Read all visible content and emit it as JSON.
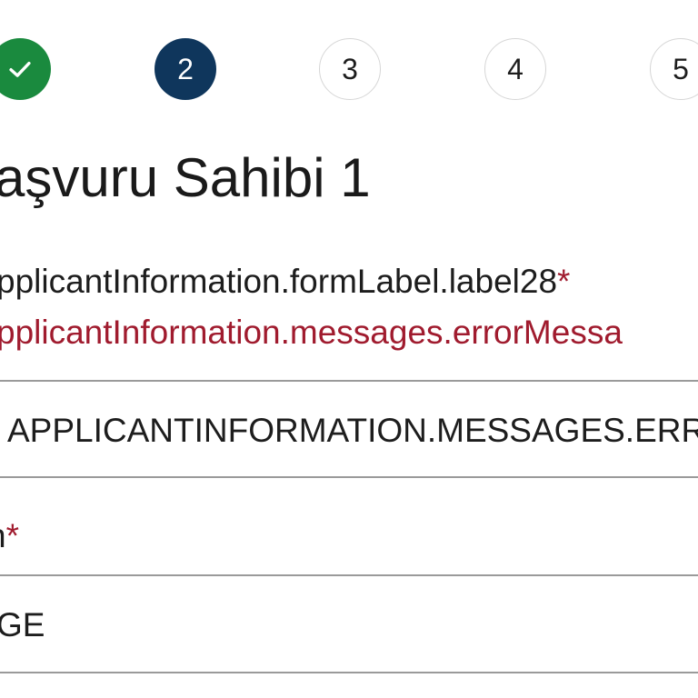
{
  "stepper": {
    "steps": [
      {
        "label": "",
        "state": "done",
        "icon": "check-icon"
      },
      {
        "label": "2",
        "state": "active"
      },
      {
        "label": "3",
        "state": "pending"
      },
      {
        "label": "4",
        "state": "pending"
      },
      {
        "label": "5",
        "state": "pending"
      }
    ]
  },
  "section": {
    "title": "aşvuru Sahibi 1"
  },
  "field1": {
    "label": "pplicantInformation.formLabel.label28",
    "required_mark": "*",
    "error": "pplicantInformation.messages.errorMessa",
    "value": "APPLICANTINFORMATION.MESSAGES.ERR"
  },
  "field2": {
    "label": "n",
    "required_mark": "*",
    "value": "GE"
  },
  "colors": {
    "done": "#1a8a3e",
    "active": "#0f365c",
    "error": "#a01b2e",
    "divider": "#9a9a9a"
  }
}
